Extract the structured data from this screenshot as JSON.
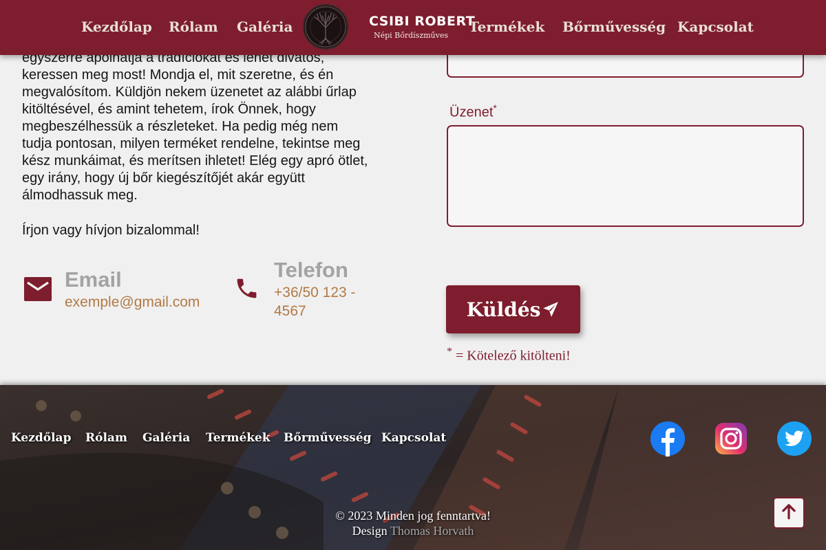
{
  "header": {
    "nav_left": [
      "Kezdőlap",
      "Rólam",
      "Galéria"
    ],
    "nav_right": [
      "Termékek",
      "Bőrművesség",
      "Kapcsolat"
    ],
    "brand_name": "CSIBI ROBERT",
    "brand_subtitle": "Népi Bőrdíszműves",
    "logo_icon": "tree-of-life-icon"
  },
  "intro": {
    "lines": [
      "egyszerre ápolhatja a tradíciókat és lehet divatos,",
      "keressen meg most! Mondja el, mit szeretne, és én",
      "megvalósítom. Küldjön nekem üzenetet az alábbi űrlap",
      "kitöltésével, és amint tehetem, írok Önnek, hogy",
      "megbeszélhessük a részleteket. Ha pedig még nem",
      "tudja pontosan, milyen terméket rendelne, tekintse meg",
      "kész munkáimat, és merítsen ihletet! Elég egy apró ötlet,",
      "egy irány, hogy új bőr kiegészítőjét akár együtt",
      "álmodhassuk meg."
    ],
    "callout": "Írjon vagy hívjon bizalommal!"
  },
  "contact": {
    "email_title": "Email",
    "email_value": "exemple@gmail.com",
    "email_icon": "envelope-icon",
    "phone_title": "Telefon",
    "phone_value_line1": "+36/50 123 -",
    "phone_value_line2": "4567",
    "phone_icon": "phone-icon"
  },
  "form": {
    "message_label": "Üzenet",
    "required_marker": "*",
    "message_value": "",
    "send_label": "Küldés",
    "send_icon": "paper-plane-icon",
    "required_note": "= Kötelező kitölteni!"
  },
  "footer": {
    "links": [
      "Kezdőlap",
      "Rólam",
      "Galéria",
      "Termékek",
      "Bőrművesség",
      "Kapcsolat"
    ],
    "social": [
      "facebook-icon",
      "instagram-icon",
      "twitter-icon"
    ],
    "copyright": "© 2023 Minden jog fenntartva!",
    "design_label": "Design",
    "designer": "Thomas Horvath"
  },
  "colors": {
    "brand": "#7d1d2d",
    "accent_text": "#b07a45",
    "muted_title": "#a3a3a3",
    "background": "#f1f0f0"
  }
}
